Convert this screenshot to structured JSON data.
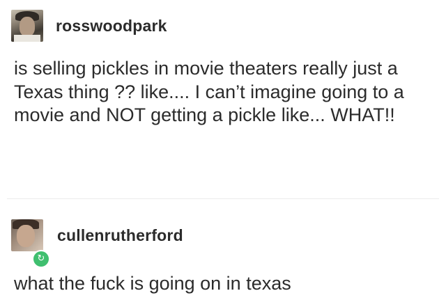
{
  "posts": [
    {
      "username": "rosswoodpark",
      "text": "is selling pickles in movie theaters really just a Texas thing ?? like.... I can’t imagine going to a movie and NOT getting a pickle like... WHAT!!"
    },
    {
      "username": "cullenrutherford",
      "text": "what the fuck is going on in texas"
    }
  ],
  "icons": {
    "reblog_badge": "↻",
    "reblog_color": "#3fbf6f"
  }
}
